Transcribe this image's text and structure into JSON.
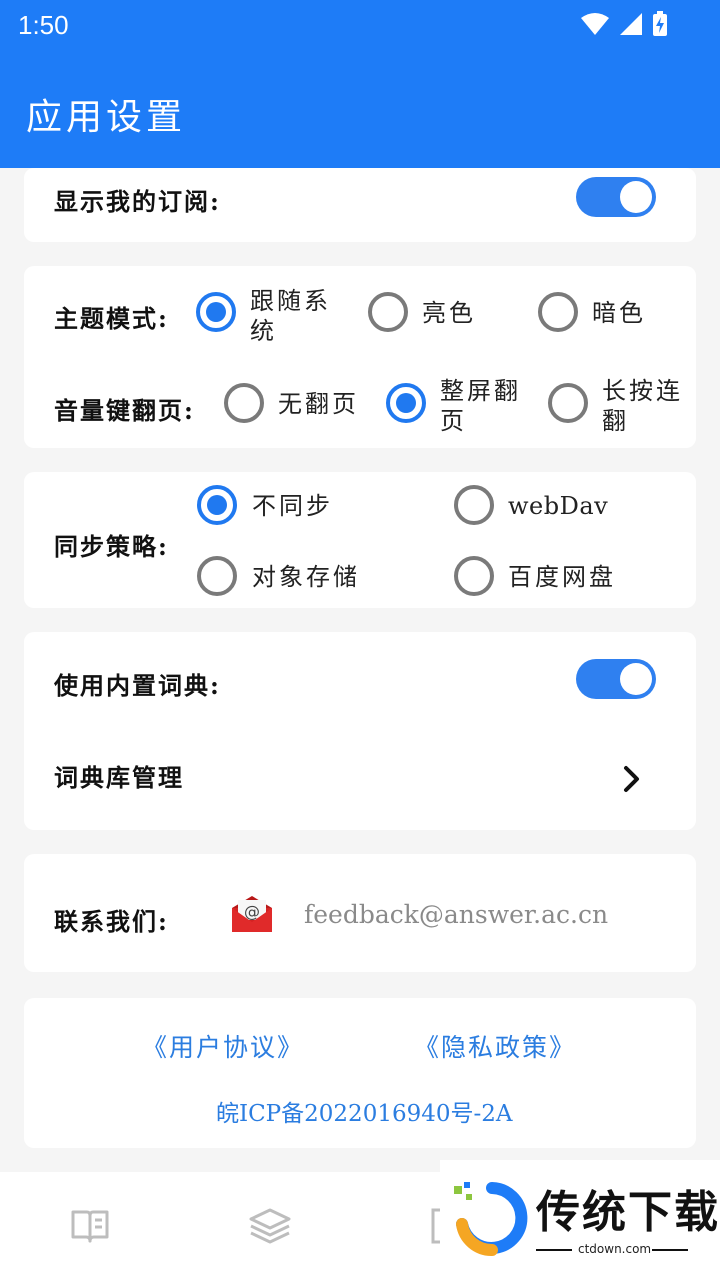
{
  "status_bar": {
    "time": "1:50"
  },
  "app_bar": {
    "title": "应用设置"
  },
  "subscription": {
    "label": "显示我的订阅:",
    "enabled": true
  },
  "theme": {
    "label": "主题模式:",
    "options": [
      {
        "line1": "跟随系",
        "line2": "统",
        "checked": true
      },
      {
        "line1": "亮色",
        "line2": "",
        "checked": false
      },
      {
        "line1": "暗色",
        "line2": "",
        "checked": false
      }
    ]
  },
  "volume_key": {
    "label": "音量键翻页:",
    "options": [
      {
        "line1": "无翻页",
        "line2": "",
        "checked": false
      },
      {
        "line1": "整屏翻",
        "line2": "页",
        "checked": true
      },
      {
        "line1": "长按连",
        "line2": "翻",
        "checked": false
      }
    ]
  },
  "sync": {
    "label": "同步策略:",
    "options": [
      {
        "text": "不同步",
        "checked": true
      },
      {
        "text": "webDav",
        "checked": false
      },
      {
        "text": "对象存储",
        "checked": false
      },
      {
        "text": "百度网盘",
        "checked": false
      }
    ]
  },
  "dictionary": {
    "builtin_label": "使用内置词典:",
    "builtin_enabled": true,
    "manage_label": "词典库管理"
  },
  "contact": {
    "label": "联系我们:",
    "email": "feedback@answer.ac.cn",
    "mail_icon": "mail-envelope-icon"
  },
  "legal": {
    "user_agreement": "《用户协议》",
    "privacy_policy": "《隐私政策》",
    "icp": "皖ICP备2022016940号-2A"
  },
  "bottom_nav": {
    "items": [
      "book-icon",
      "layers-icon",
      "frame-icon"
    ]
  },
  "watermark": {
    "text": "传统下载",
    "url": "ctdown.com"
  },
  "colors": {
    "primary": "#1e7cf7",
    "toggle": "#2f80f0",
    "radio_checked": "#2079f0",
    "link": "#2b7de0"
  }
}
